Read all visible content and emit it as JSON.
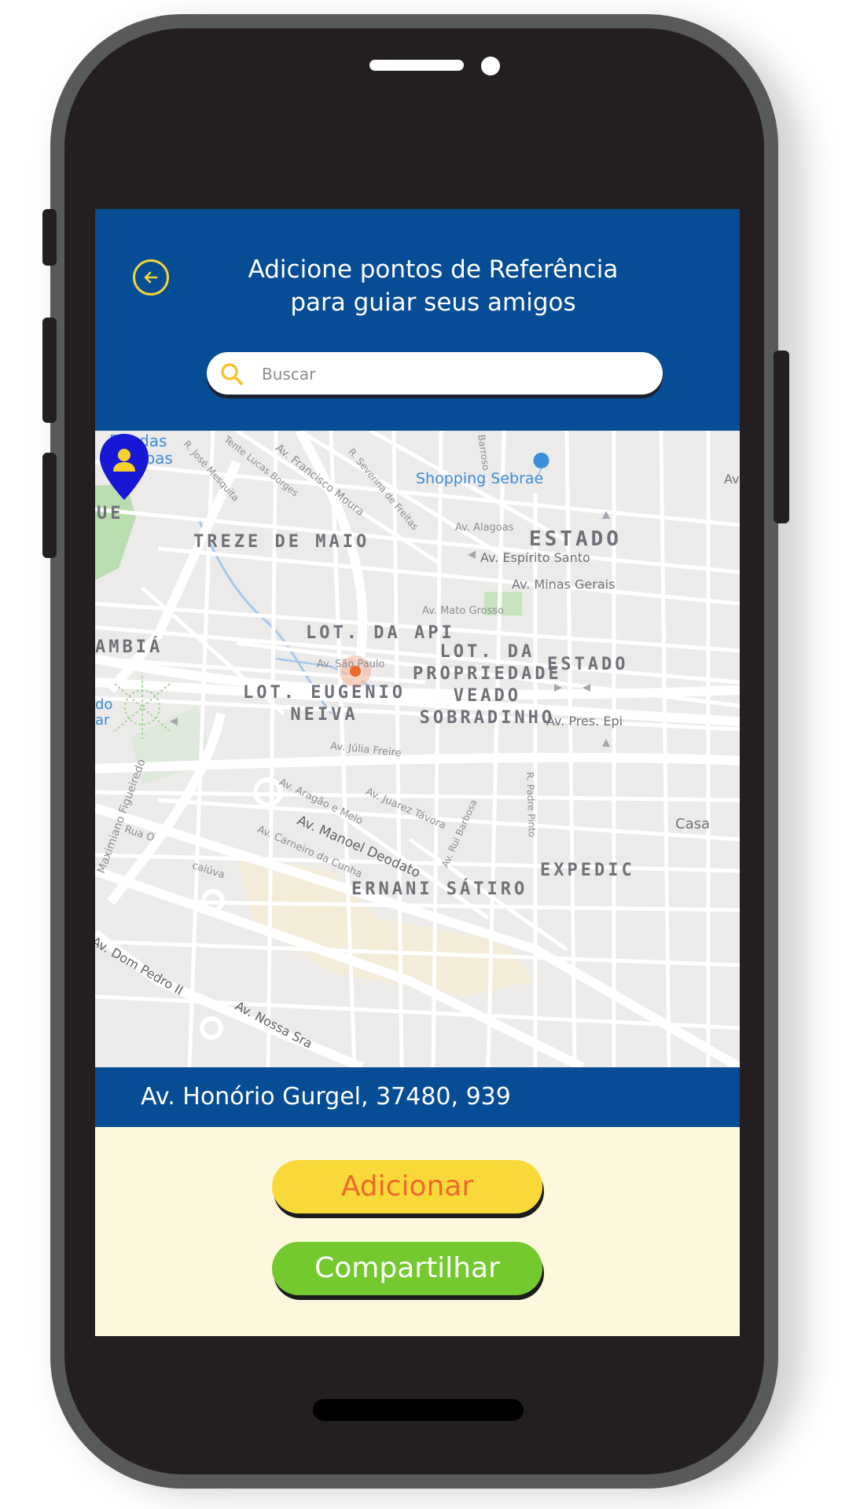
{
  "header": {
    "title_line1": "Adicione pontos de Referência",
    "title_line2": "para guiar seus amigos",
    "back_icon": "arrow-left-circle-icon",
    "accent_color": "#f3d43a",
    "background_color": "#074d95"
  },
  "search": {
    "placeholder": "Buscar",
    "value": "",
    "icon": "search-icon"
  },
  "map": {
    "areas": {
      "rio_das_bombas_1": "Rio das",
      "rio_das_bombas_2": "Bombas",
      "treze_de_maio": "TREZE DE MAIO",
      "estado_top": "ESTADO",
      "ue": "UE",
      "lot_da_api": "LOT. DA API",
      "ambia": "AMBIÁ",
      "lot_eugenio_1": "LOT. EUGENIO",
      "lot_eugenio_2": "NEIVA",
      "lot_propriedade_1": "LOT. DA",
      "lot_propriedade_2": "PROPRIEDADE",
      "lot_propriedade_3": "VEADO",
      "lot_propriedade_4": "SOBRADINHO",
      "estado_mid": "ESTADO",
      "ernani_satiro": "ERNANI SÁTIRO",
      "expedic": "EXPEDIC",
      "casa": "Casa",
      "do_left": "do",
      "ar_left": "ar"
    },
    "streets": {
      "francisco_moura": "Av. Francisco Moura",
      "jose_mesquita": "R. José Mesquita",
      "lucas_borges": "Tente Lucas Borges",
      "severina_freitas": "R. Severina de Freitas",
      "barroso": "Barroso",
      "alagoas": "Av. Alagoas",
      "espirito_santo": "Av. Espírito Santo",
      "minas_gerais": "Av. Minas Gerais",
      "mato_grosso": "Av. Mato Grosso",
      "sao_paulo": "Av. São Paulo",
      "pres_epi": "Av. Pres. Epi",
      "julia_freire": "Av. Júlia Freire",
      "maximiano_figueiredo": "Maximiano Figueiredo",
      "aragao_melo": "Av. Aragão e Melo",
      "juarez_tavora": "Av. Juarez Távora",
      "manoel_deodato": "Av. Manoel Deodato",
      "carneiro_cunha": "Av. Carneiro da Cunha",
      "rui_barbosa": "Av. Rui Barbosa",
      "padre_pinto": "R. Padre Pinto",
      "rua_o": "Rua O",
      "caiuva": "caiúva",
      "dom_pedro": "Av. Dom Pedro II",
      "nossa_sra": "Av. Nossa Sra",
      "av_right": "Av"
    },
    "poi": {
      "shopping_sebrae": "Shopping Sebrae"
    },
    "marker_icon": "user-location-pin-icon",
    "marker_color": "#1717d6"
  },
  "address": {
    "text": "Av. Honório Gurgel, 37480, 939"
  },
  "actions": {
    "add_label": "Adicionar",
    "share_label": "Compartilhar",
    "add_color": "#f9d93a",
    "share_color": "#74c92f"
  }
}
